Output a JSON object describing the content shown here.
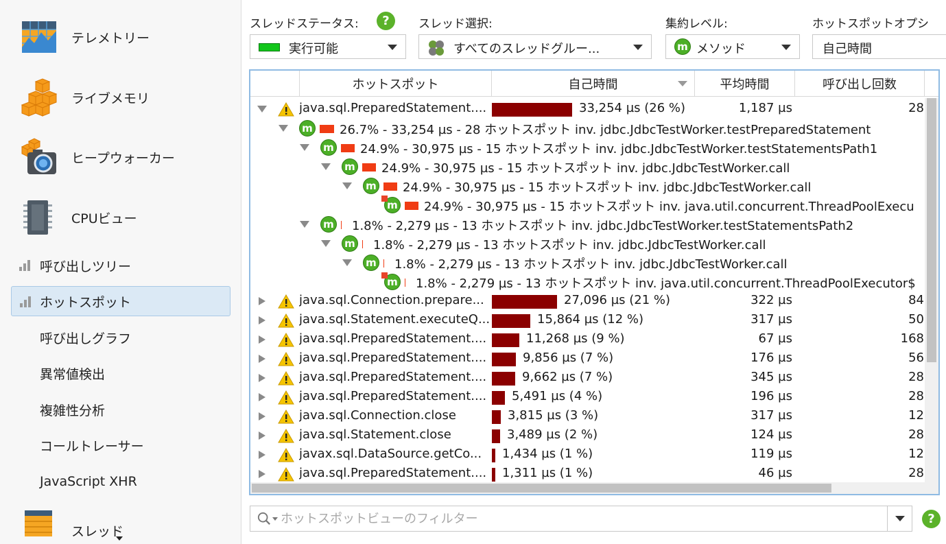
{
  "sidebar": {
    "big_items": [
      {
        "label": "テレメトリー",
        "icon": "telemetry-icon"
      },
      {
        "label": "ライブメモリ",
        "icon": "live-memory-icon"
      },
      {
        "label": "ヒープウォーカー",
        "icon": "heap-walker-icon"
      },
      {
        "label": "CPUビュー",
        "icon": "cpu-icon"
      }
    ],
    "sub_items": [
      {
        "label": "呼び出しツリー"
      },
      {
        "label": "ホットスポット"
      },
      {
        "label": "呼び出しグラフ"
      },
      {
        "label": "異常値検出"
      },
      {
        "label": "複雑性分析"
      },
      {
        "label": "コールトレーサー"
      },
      {
        "label": "JavaScript XHR"
      }
    ],
    "partial_item": {
      "label": "スレッド",
      "icon": "threads-icon"
    },
    "selected_index": 1
  },
  "toolbar": {
    "thread_status": {
      "label": "スレッドステータス:",
      "value": "実行可能",
      "indicator_color": "#12c61b"
    },
    "thread_selection": {
      "label": "スレッド選択:",
      "value": "すべてのスレッドグルー..."
    },
    "aggregation": {
      "label": "集約レベル:",
      "value": "メソッド"
    },
    "hotspot_option": {
      "label": "ホットスポットオプシ",
      "value": "自己時間"
    }
  },
  "table": {
    "headers": {
      "hotspot": "ホットスポット",
      "self_time": "自己時間",
      "avg_time": "平均時間",
      "calls": "呼び出し回数"
    },
    "max_self_time_us": 33254,
    "top_rows": [
      {
        "name": "java.sql.PreparedStatement....",
        "self_us": 33254,
        "self": "33,254 µs (26 %)",
        "avg": "1,187 µs",
        "calls": "28",
        "expanded": true
      },
      {
        "name": "java.sql.Connection.prepare...",
        "self_us": 27096,
        "self": "27,096 µs (21 %)",
        "avg": "322 µs",
        "calls": "84"
      },
      {
        "name": "java.sql.Statement.executeQ...",
        "self_us": 15864,
        "self": "15,864 µs (12 %)",
        "avg": "317 µs",
        "calls": "50"
      },
      {
        "name": "java.sql.PreparedStatement....",
        "self_us": 11268,
        "self": "11,268 µs (9 %)",
        "avg": "67 µs",
        "calls": "168"
      },
      {
        "name": "java.sql.PreparedStatement....",
        "self_us": 9856,
        "self": "9,856 µs (7 %)",
        "avg": "176 µs",
        "calls": "56"
      },
      {
        "name": "java.sql.PreparedStatement....",
        "self_us": 9662,
        "self": "9,662 µs (7 %)",
        "avg": "345 µs",
        "calls": "28"
      },
      {
        "name": "java.sql.PreparedStatement....",
        "self_us": 5491,
        "self": "5,491 µs (4 %)",
        "avg": "196 µs",
        "calls": "28"
      },
      {
        "name": "java.sql.Connection.close",
        "self_us": 3815,
        "self": "3,815 µs (3 %)",
        "avg": "317 µs",
        "calls": "12"
      },
      {
        "name": "java.sql.Statement.close",
        "self_us": 3489,
        "self": "3,489 µs (2 %)",
        "avg": "124 µs",
        "calls": "28"
      },
      {
        "name": "javax.sql.DataSource.getCo...",
        "self_us": 1434,
        "self": "1,434 µs (1 %)",
        "avg": "119 µs",
        "calls": "12"
      },
      {
        "name": "java.sql.PreparedStatement....",
        "self_us": 1311,
        "self": "1,311 µs (1 %)",
        "avg": "46 µs",
        "calls": "28"
      }
    ],
    "backtraces": [
      {
        "depth": 1,
        "pct": 0.267,
        "text": "26.7% - 33,254 µs - 28 ホットスポット inv. jdbc.JdbcTestWorker.testPreparedStatement",
        "expanded": true
      },
      {
        "depth": 2,
        "pct": 0.249,
        "text": "24.9% - 30,975 µs - 15 ホットスポット inv. jdbc.JdbcTestWorker.testStatementsPath1",
        "expanded": true
      },
      {
        "depth": 3,
        "pct": 0.249,
        "text": "24.9% - 30,975 µs - 15 ホットスポット inv. jdbc.JdbcTestWorker.call",
        "expanded": true
      },
      {
        "depth": 4,
        "pct": 0.249,
        "text": "24.9% - 30,975 µs - 15 ホットスポット inv. jdbc.JdbcTestWorker.call",
        "expanded": true
      },
      {
        "depth": 5,
        "pct": 0.249,
        "text": "24.9% - 30,975 µs - 15 ホットスポット inv. java.util.concurrent.ThreadPoolExecu",
        "leaf": true
      },
      {
        "depth": 2,
        "pct": 0.018,
        "text": "1.8% - 2,279 µs - 13 ホットスポット inv. jdbc.JdbcTestWorker.testStatementsPath2",
        "expanded": true
      },
      {
        "depth": 3,
        "pct": 0.018,
        "text": "1.8% - 2,279 µs - 13 ホットスポット inv. jdbc.JdbcTestWorker.call",
        "expanded": true
      },
      {
        "depth": 4,
        "pct": 0.018,
        "text": "1.8% - 2,279 µs - 13 ホットスポット inv. jdbc.JdbcTestWorker.call",
        "expanded": true
      },
      {
        "depth": 5,
        "pct": 0.018,
        "text": "1.8% - 2,279 µs - 13 ホットスポット inv. java.util.concurrent.ThreadPoolExecutor$",
        "leaf": true
      }
    ]
  },
  "filter": {
    "placeholder": "ホットスポットビューのフィルター",
    "value": ""
  },
  "colors": {
    "bar": "#8b0000",
    "mini_bar": "#f03c14",
    "method_icon": "#4caf27",
    "accent": "#8fbbe3"
  }
}
